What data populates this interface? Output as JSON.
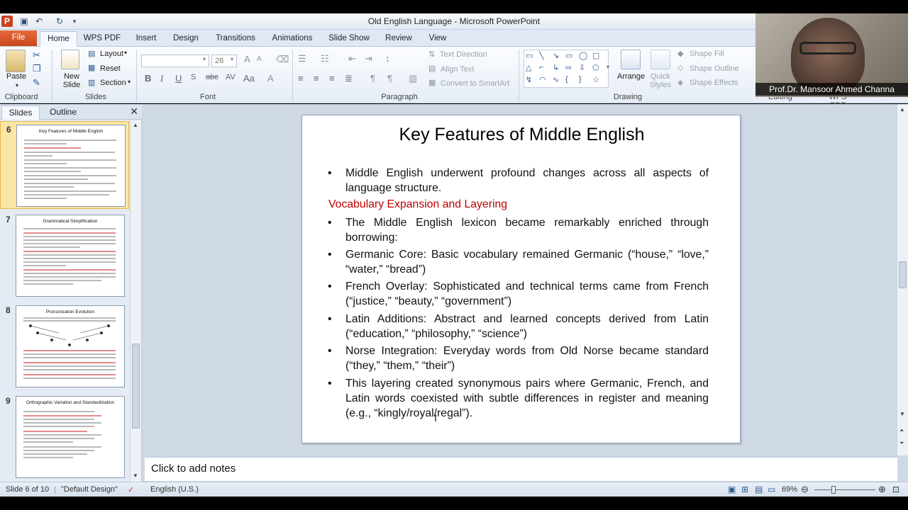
{
  "window": {
    "title": "Old English Language  -  Microsoft PowerPoint",
    "app_badge": "P"
  },
  "tabs": [
    "File",
    "Home",
    "WPS PDF",
    "Insert",
    "Design",
    "Transitions",
    "Animations",
    "Slide Show",
    "Review",
    "View"
  ],
  "ribbon": {
    "clipboard": {
      "paste": "Paste",
      "label": "Clipboard"
    },
    "slides": {
      "new_slide": "New Slide",
      "layout": "Layout",
      "reset": "Reset",
      "section": "Section",
      "label": "Slides"
    },
    "font": {
      "size": "28",
      "label": "Font"
    },
    "paragraph": {
      "text_direction": "Text Direction",
      "align_text": "Align Text",
      "convert_smartart": "Convert to SmartArt",
      "label": "Paragraph"
    },
    "drawing": {
      "arrange": "Arrange",
      "quick_styles": "Quick Styles",
      "shape_fill": "Shape Fill",
      "shape_outline": "Shape Outline",
      "shape_effects": "Shape Effects",
      "label": "Drawing"
    },
    "editing": {
      "label": "Editing",
      "wps_pdf": "WPS PDF"
    }
  },
  "webcam": {
    "name": "Prof.Dr. Mansoor Ahmed Channa"
  },
  "pane": {
    "tabs": {
      "slides": "Slides",
      "outline": "Outline"
    },
    "thumbnails": [
      {
        "number": "6",
        "title": "Key Features of Middle English",
        "selected": true
      },
      {
        "number": "7",
        "title": "Grammatical Simplification",
        "selected": false
      },
      {
        "number": "8",
        "title": "Pronunciation Evolution",
        "selected": false
      },
      {
        "number": "9",
        "title": "Orthographic Variation and Standardization",
        "selected": false
      }
    ]
  },
  "slide": {
    "title": "Key Features of Middle English",
    "bullets_top": [
      "Middle English underwent profound changes across all aspects of language structure."
    ],
    "subheading": "Vocabulary Expansion and Layering",
    "bullets": [
      "The Middle English lexicon became remarkably enriched through borrowing:",
      "Germanic Core: Basic vocabulary remained Germanic (“house,” “love,” “water,” “bread”)",
      "French Overlay: Sophisticated and technical terms came from French (“justice,” “beauty,” “government”)",
      "Latin Additions: Abstract and learned concepts derived from Latin (“education,” “philosophy,” “science”)",
      "Norse Integration: Everyday words from Old Norse became standard (“they,” “them,” “their”)",
      "This layering created synonymous pairs where Germanic, French, and Latin words coexisted with subtle differences in register and meaning (e.g., “kingly/royal/regal”)."
    ]
  },
  "notes": {
    "placeholder": "Click to add notes"
  },
  "status": {
    "slide_counter": "Slide 6 of 10",
    "theme": "\"Default Design\"",
    "language": "English (U.S.)",
    "zoom": "69%"
  },
  "colors": {
    "accent_red": "#c00000",
    "file_tab": "#d6532a",
    "selected_thumb": "#fbe6a5"
  },
  "icons": [
    "save-icon",
    "undo-icon",
    "redo-icon",
    "paste-icon",
    "cut-icon",
    "copy-icon",
    "format-painter-icon",
    "bold-icon",
    "italic-icon",
    "underline-icon",
    "close-icon",
    "normal-view-icon",
    "slide-sorter-icon",
    "reading-view-icon",
    "slideshow-icon",
    "zoom-out-icon",
    "zoom-in-icon",
    "fit-slide-icon"
  ]
}
